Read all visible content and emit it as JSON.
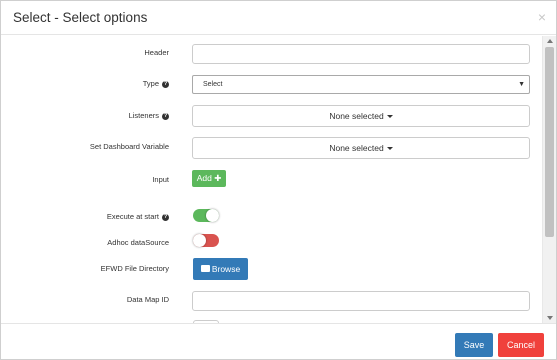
{
  "dialog": {
    "title": "Select - Select options",
    "close": "×"
  },
  "form": {
    "header": {
      "label": "Header",
      "value": ""
    },
    "type": {
      "label": "Type",
      "selected": "Select",
      "arrow": "▼"
    },
    "listeners": {
      "label": "Listeners",
      "value": "None selected"
    },
    "dashboard_variable": {
      "label": "Set Dashboard Variable",
      "value": "None selected"
    },
    "input": {
      "label": "Input",
      "button": "Add",
      "plus": "✚"
    },
    "execute_at_start": {
      "label": "Execute at start",
      "state": "on"
    },
    "adhoc_datasource": {
      "label": "Adhoc dataSource",
      "state": "off"
    },
    "efwd_file_directory": {
      "label": "EFWD File Directory",
      "button": "Browse"
    },
    "data_map_id": {
      "label": "Data Map ID",
      "value": ""
    }
  },
  "help_icon": "?",
  "footer": {
    "save": "Save",
    "cancel": "Cancel"
  },
  "colors": {
    "primary": "#337ab7",
    "success": "#5cb85c",
    "danger": "#d9534f",
    "cancel": "#f0413c"
  }
}
